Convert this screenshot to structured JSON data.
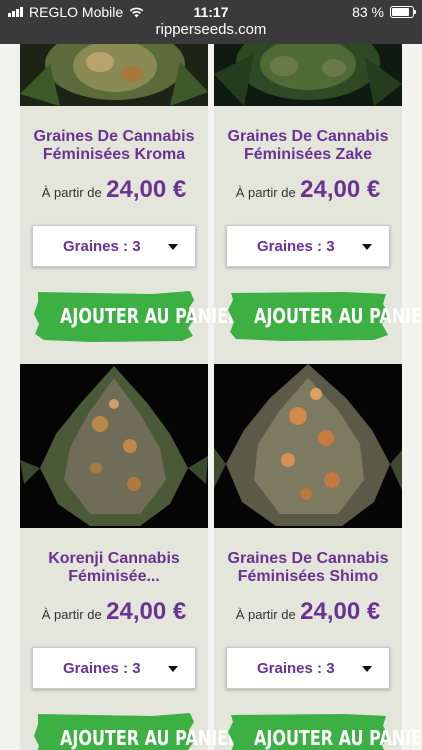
{
  "status_bar": {
    "carrier": "REGLO Mobile",
    "time": "11:17",
    "battery": "83 %",
    "battery_level": 0.83,
    "url": "ripperseeds.com",
    "icons": [
      "signal-icon",
      "wifi-icon",
      "battery-icon"
    ]
  },
  "colors": {
    "brand_purple": "#6a3391",
    "cart_green": "#3cb043",
    "column_bg": "#e4e6dc"
  },
  "products": [
    {
      "title_1": "Graines De Cannabis",
      "title_2": "Féminisées Kroma",
      "price_prefix": "À partir de",
      "price": "24,00 €",
      "select_label": "Graines : 3",
      "cart_label": "AJOUTER AU PANIER"
    },
    {
      "title_1": "Graines De Cannabis",
      "title_2": "Féminisées Zake",
      "price_prefix": "À partir de",
      "price": "24,00 €",
      "select_label": "Graines : 3",
      "cart_label": "AJOUTER AU PANIER"
    },
    {
      "title_1": "Korenji Cannabis",
      "title_2": "Féminisée...",
      "price_prefix": "À partir de",
      "price": "24,00 €",
      "select_label": "Graines : 3",
      "cart_label": "AJOUTER AU PANIER"
    },
    {
      "title_1": "Graines De Cannabis",
      "title_2": "Féminisées Shimo",
      "price_prefix": "À partir de",
      "price": "24,00 €",
      "select_label": "Graines : 3",
      "cart_label": "AJOUTER AU PANIER"
    }
  ]
}
